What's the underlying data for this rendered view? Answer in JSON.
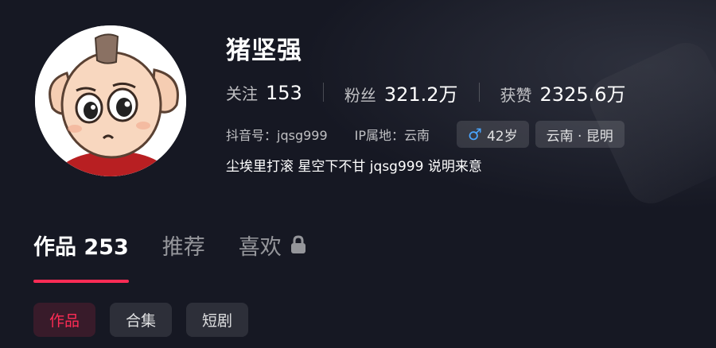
{
  "profile": {
    "nickname": "猪坚强",
    "stats": {
      "following_label": "关注",
      "following_value": "153",
      "followers_label": "粉丝",
      "followers_value": "321.2万",
      "likes_label": "获赞",
      "likes_value": "2325.6万"
    },
    "douyin_id": "抖音号：jqsg999",
    "ip_location": "IP属地：云南",
    "gender_symbol": "♂",
    "age": "42岁",
    "location_tag": "云南 · 昆明",
    "bio": "尘埃里打滚 星空下不甘 jqsg999 说明来意"
  },
  "tabs": [
    {
      "label": "作品 253",
      "active": true
    },
    {
      "label": "推荐",
      "active": false
    },
    {
      "label": "喜欢",
      "active": false,
      "icon": "lock-icon"
    }
  ],
  "subtabs": [
    {
      "label": "作品",
      "active": true
    },
    {
      "label": "合集",
      "active": false
    },
    {
      "label": "短剧",
      "active": false
    }
  ],
  "colors": {
    "background": "#161823",
    "accent": "#fe2c55",
    "male_blue": "#4aa5ff"
  }
}
